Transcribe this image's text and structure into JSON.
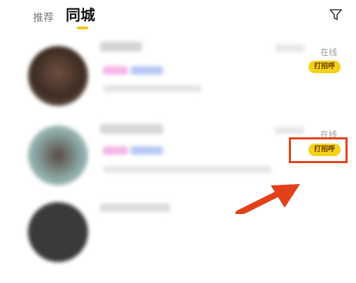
{
  "tabs": [
    {
      "label": "推荐",
      "active": false
    },
    {
      "label": "同城",
      "active": true
    }
  ],
  "users": [
    {
      "status": "在线",
      "greet_label": "打招呼"
    },
    {
      "status": "在线",
      "greet_label": "打招呼"
    }
  ],
  "colors": {
    "accent": "#f2c41a",
    "greet_bg": "#f5d21a",
    "highlight": "#e2411a",
    "status_text": "#9a9a9a"
  }
}
